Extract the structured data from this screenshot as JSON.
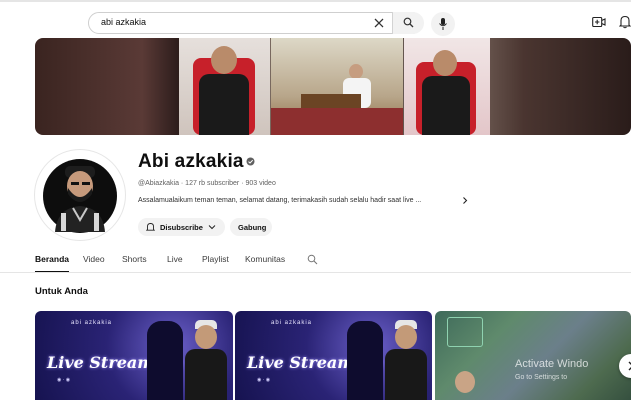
{
  "search": {
    "query": "abi azkakia",
    "clear_icon": "close-icon",
    "search_icon": "search-icon",
    "mic_icon": "mic-icon"
  },
  "header_icons": [
    "create-video-icon",
    "bell-icon"
  ],
  "channel": {
    "name": "Abi azkakia",
    "verified": true,
    "meta": "@Abiazkakia · 127 rb subscriber · 903 video",
    "description": "Assalamualaikum teman teman, selamat datang, terimakasih sudah selalu hadir saat live ...",
    "subscribe_label": "Disubscribe",
    "join_label": "Gabung"
  },
  "tabs": [
    {
      "label": "Beranda",
      "active": true
    },
    {
      "label": "Video",
      "active": false
    },
    {
      "label": "Shorts",
      "active": false
    },
    {
      "label": "Live",
      "active": false
    },
    {
      "label": "Playlist",
      "active": false
    },
    {
      "label": "Komunitas",
      "active": false
    }
  ],
  "section": {
    "title": "Untuk Anda"
  },
  "videos": [
    {
      "brand": "abi azkakia",
      "title": "Live Streaming"
    },
    {
      "brand": "abi azkakia",
      "title": "Live Streaming"
    },
    {
      "brand": "",
      "title": ""
    }
  ],
  "watermark": {
    "line1": "Activate Windo",
    "line2": "Go to Settings to"
  },
  "colors": {
    "accent": "#0f0f0f",
    "pill_bg": "#f2f2f2",
    "stream_purple": "#2a2375"
  }
}
